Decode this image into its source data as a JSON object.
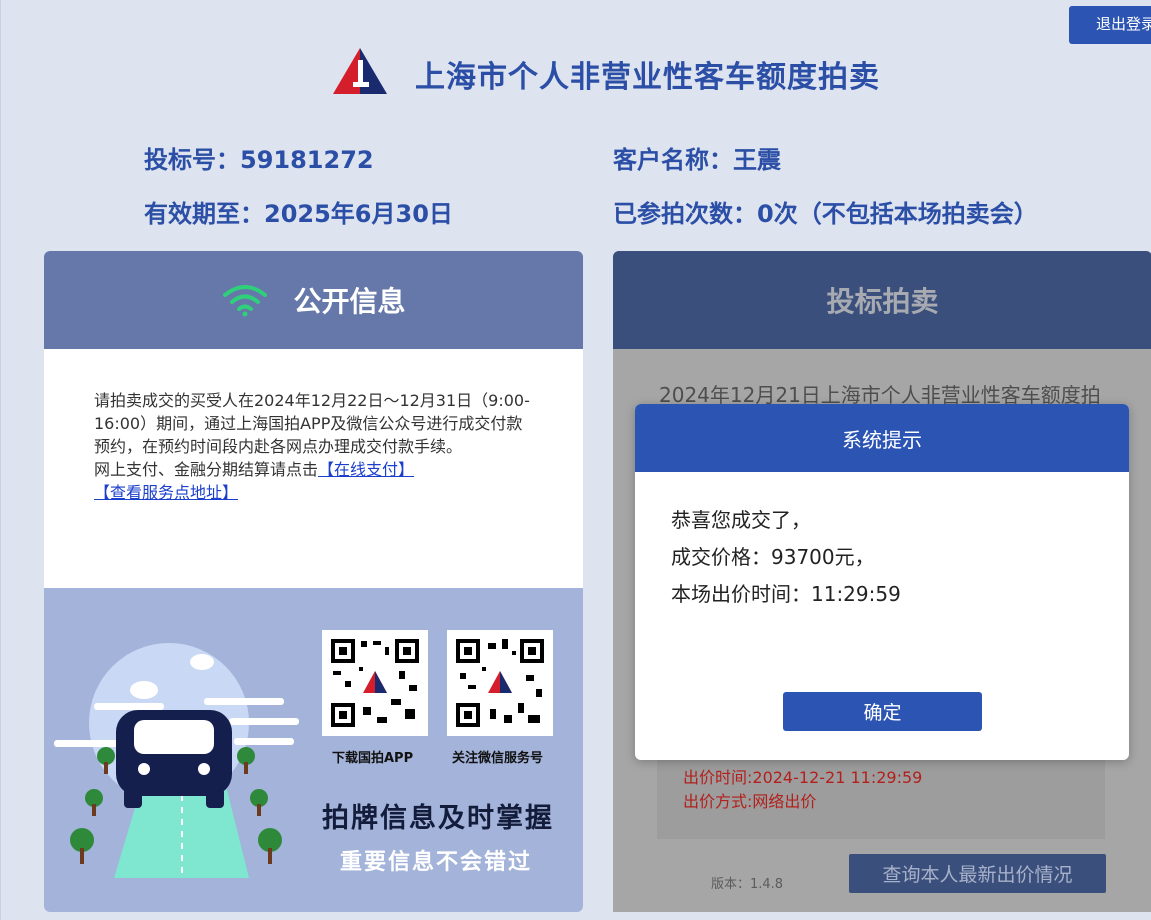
{
  "header": {
    "logout_label": "退出登录",
    "title": "上海市个人非营业性客车额度拍卖"
  },
  "user": {
    "bid_no_label": "投标号：59181272",
    "customer_label": "客户名称：王震",
    "valid_label": "有效期至：2025年6月30日",
    "count_label": "已参拍次数：0次（不包括本场拍卖会）"
  },
  "public_info": {
    "title": "公开信息",
    "paragraph": "请拍卖成交的买受人在2024年12月22日～12月31日（9:00-16:00）期间，通过上海国拍APP及微信公众号进行成交付款预约，在预约时间段内赴各网点办理成交付款手续。",
    "pay_prefix": "网上支付、金融分期结算请点击",
    "online_pay_link": "【在线支付】",
    "service_link": "【查看服务点地址】",
    "qr_app_label": "下载国拍APP",
    "qr_wechat_label": "关注微信服务号",
    "slogan_main": "拍牌信息及时掌握",
    "slogan_sub": "重要信息不会错过"
  },
  "auction": {
    "title": "投标拍卖",
    "auction_line": "2024年12月21日上海市个人非营业性客车额度拍",
    "bid_time": "出价时间:2024-12-21 11:29:59",
    "bid_method": "出价方式:网络出价",
    "version": "版本：1.4.8",
    "query_button": "查询本人最新出价情况"
  },
  "modal": {
    "title": "系统提示",
    "line1": "恭喜您成交了，",
    "line2": "成交价格：93700元，",
    "line3": "本场出价时间：11:29:59",
    "confirm": "确定"
  },
  "colors": {
    "brand_blue": "#2c55b3",
    "title_blue": "#2b4ea6",
    "bid_red": "#b3201c"
  }
}
